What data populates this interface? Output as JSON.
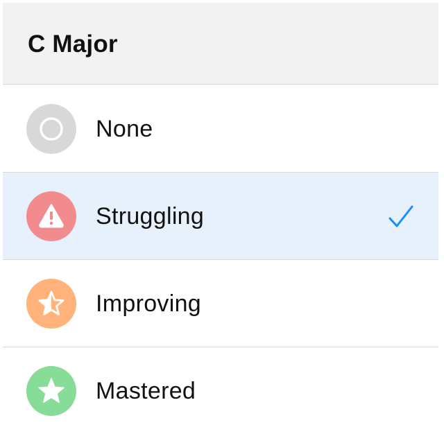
{
  "header": {
    "title": "C Major"
  },
  "options": [
    {
      "label": "None",
      "icon": "empty-circle-icon",
      "color": "#d8d8d8",
      "selected": false
    },
    {
      "label": "Struggling",
      "icon": "warning-triangle-icon",
      "color": "#f28b8d",
      "selected": true
    },
    {
      "label": "Improving",
      "icon": "half-star-icon",
      "color": "#ffb37b",
      "selected": false
    },
    {
      "label": "Mastered",
      "icon": "star-icon",
      "color": "#87dc97",
      "selected": false
    }
  ],
  "colors": {
    "header_background": "#f2f2f2",
    "selected_row_background": "#e6f1fc",
    "checkmark": "#1a8cff",
    "separator": "#d7d7d7"
  }
}
